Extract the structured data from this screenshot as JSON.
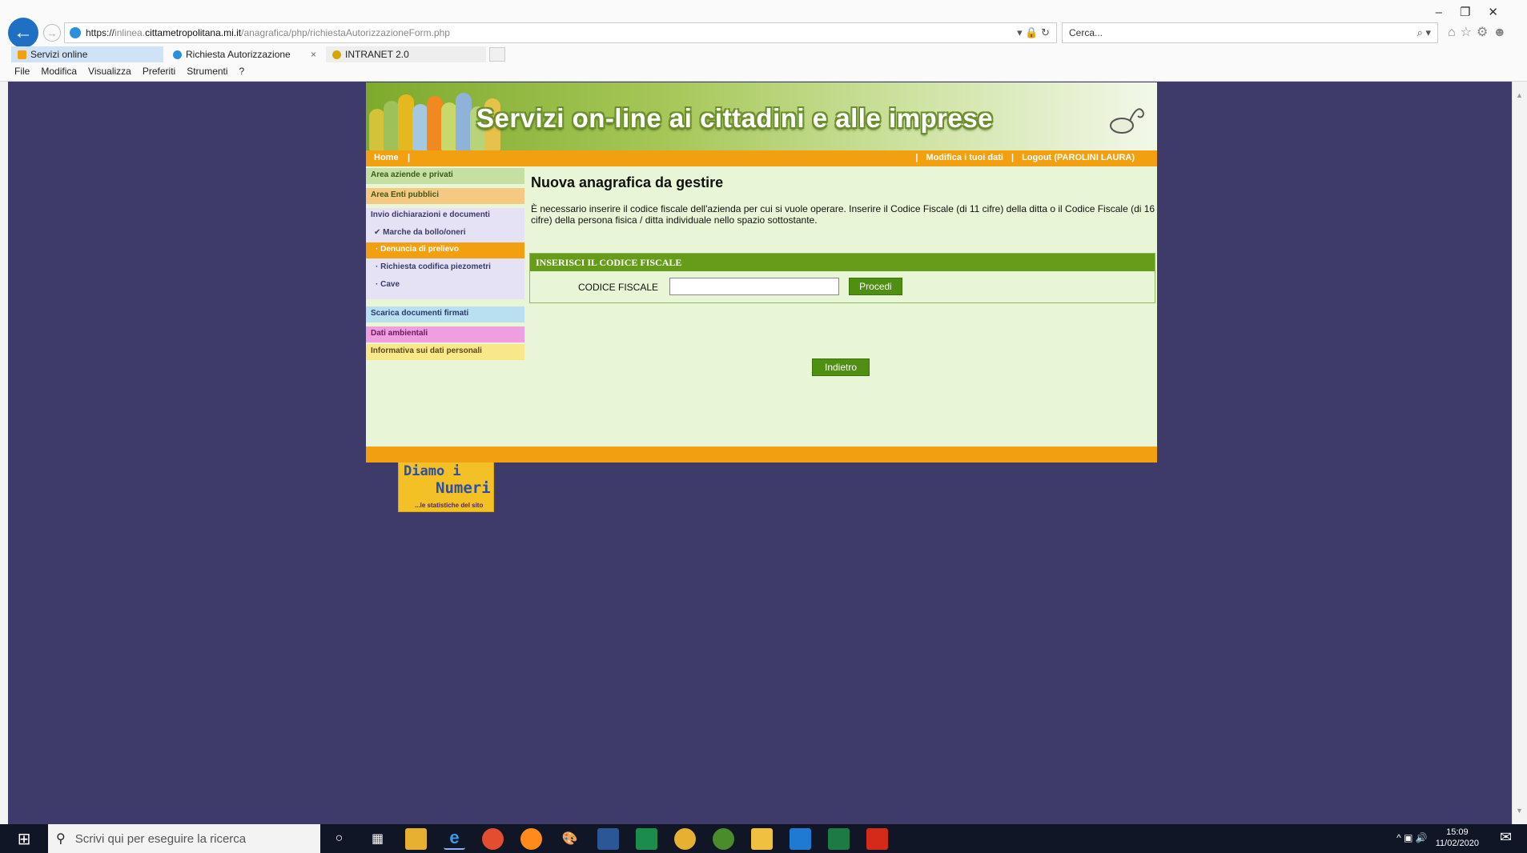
{
  "browser": {
    "url_prefix": "https://",
    "url_dim1": "inlinea.",
    "url_domain": "cittametropolitana.mi.it",
    "url_path": "/anagrafica/php/richiestaAutorizzazioneForm.php",
    "search_placeholder": "Cerca...",
    "tabs": [
      {
        "label": "Servizi online",
        "active": true
      },
      {
        "label": "Richiesta Autorizzazione",
        "close": "×"
      },
      {
        "label": "INTRANET 2.0"
      }
    ],
    "menu": [
      "File",
      "Modifica",
      "Visualizza",
      "Preferiti",
      "Strumenti",
      "?"
    ]
  },
  "site": {
    "banner_title": "Servizi on-line ai cittadini e alle imprese",
    "nav": {
      "home": "Home",
      "edit_data": "Modifica i tuoi dati",
      "logout": "Logout (PAROLINI LAURA)"
    },
    "sidebar": {
      "items": [
        {
          "label": "Area aziende e privati",
          "bg": "#c5e0a3"
        },
        {
          "label": "Area Enti pubblici",
          "bg": "#f6c982"
        },
        {
          "label": "Invio dichiarazioni e documenti",
          "bg": "#e6e2f5"
        },
        {
          "label": "Scarica documenti firmati",
          "bg": "#b9e0f0"
        },
        {
          "label": "Dati ambientali",
          "bg": "#ef9ee0"
        },
        {
          "label": "Informativa sui dati personali",
          "bg": "#f8e88a"
        }
      ],
      "subitems": [
        {
          "label": "✔ Marche da bollo/oneri"
        },
        {
          "label": "Denuncia di prelievo",
          "active": true
        },
        {
          "label": "Richiesta codifica piezometri"
        },
        {
          "label": "Cave"
        }
      ],
      "logo": {
        "line1": "Diamo i",
        "line2": "Numeri",
        "line3": "...le statistiche del sito"
      }
    },
    "main": {
      "title": "Nuova anagrafica da gestire",
      "intro": "È necessario inserire il codice fiscale dell'azienda per cui si vuole operare. Inserire il Codice Fiscale (di 11 cifre) della ditta o il Codice Fiscale (di 16 cifre) della persona fisica / ditta individuale nello spazio sottostante.",
      "panel_title": "INSERISCI IL CODICE FISCALE",
      "cf_label": "CODICE FISCALE",
      "cf_value": "",
      "procedi": "Procedi",
      "indietro": "Indietro"
    }
  },
  "taskbar": {
    "search_placeholder": "Scrivi qui per eseguire la ricerca",
    "time": "15:09",
    "date": "11/02/2020"
  },
  "colors": {
    "background": "#3e3b6b",
    "orange": "#f2a010",
    "green": "#4f8f12",
    "page_bg": "#e8f5d6"
  }
}
